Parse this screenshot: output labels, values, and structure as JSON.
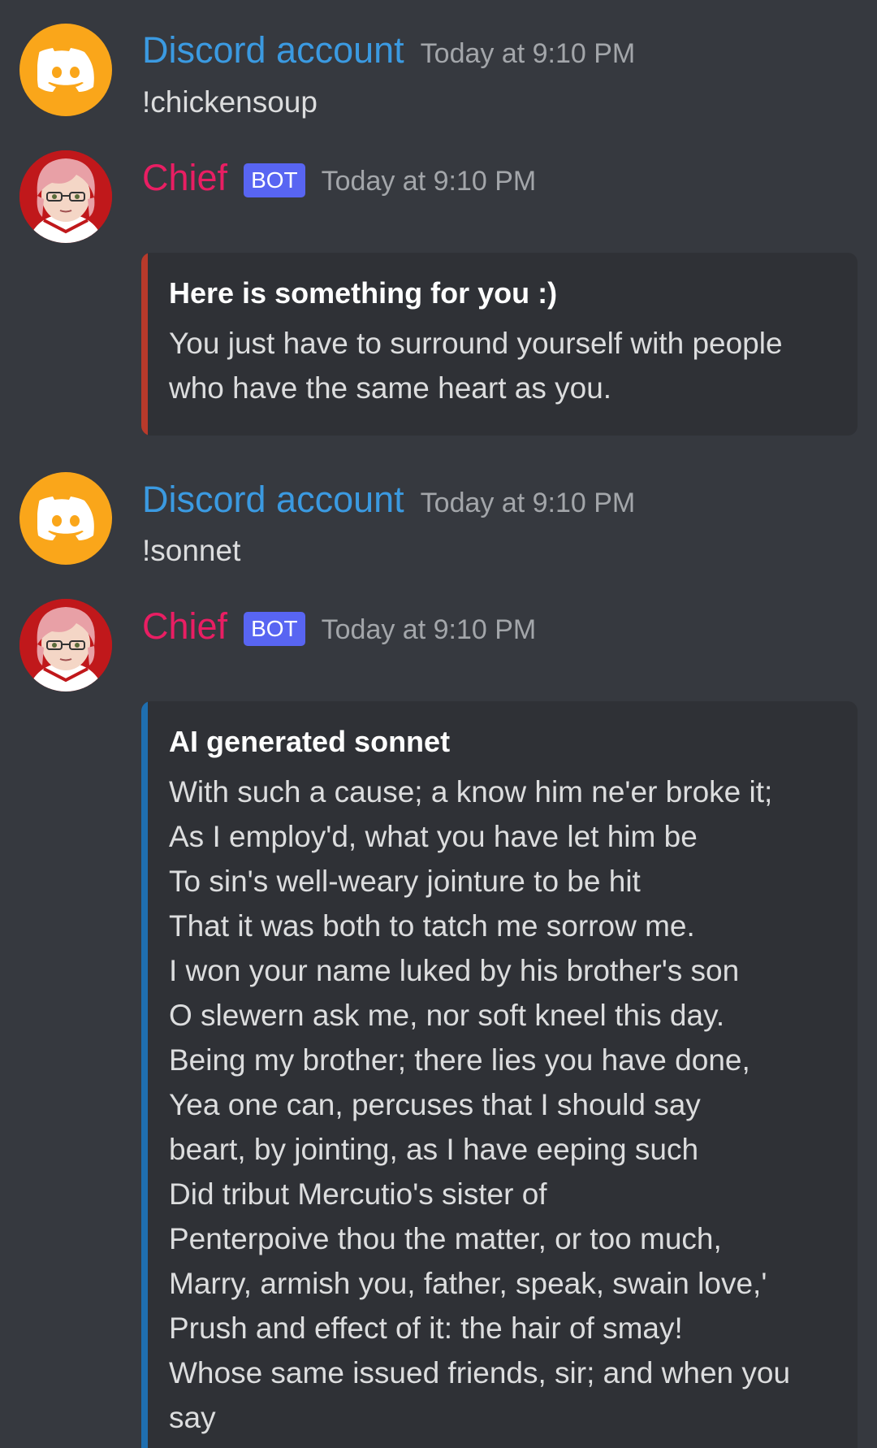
{
  "colors": {
    "background": "#36393f",
    "embed_bg": "#2f3136",
    "discord_avatar": "#faa61a",
    "username_blue": "#3b9ae1",
    "username_pink": "#e91e63",
    "bot_tag": "#5865f2",
    "embed_bar_red": "#b83a2b",
    "embed_bar_blue": "#1f6fb0"
  },
  "messages": [
    {
      "author": "Discord account",
      "avatar_icon": "discord-logo-icon",
      "timestamp": "Today at 9:10 PM",
      "content": "!chickensoup"
    },
    {
      "author": "Chief",
      "bot_tag": "BOT",
      "avatar_icon": "anime-character-avatar",
      "timestamp": "Today at 9:10 PM",
      "embed": {
        "title": "Here is something for you :)",
        "lines": [
          "You just have to surround yourself with people",
          "who have the same heart as you."
        ]
      }
    },
    {
      "author": "Discord account",
      "avatar_icon": "discord-logo-icon",
      "timestamp": "Today at 9:10 PM",
      "content": "!sonnet"
    },
    {
      "author": "Chief",
      "bot_tag": "BOT",
      "avatar_icon": "anime-character-avatar",
      "timestamp": "Today at 9:10 PM",
      "embed": {
        "title": "AI generated sonnet",
        "lines": [
          "With such a cause; a know him ne'er broke it;",
          "As I employ'd, what you have let him be",
          "To sin's well-weary jointure to be hit",
          "That it was both to tatch me sorrow me.",
          "I won your name luked by his brother's son",
          "O slewern ask me, nor soft kneel this day.",
          "Being my brother; there lies you have done,",
          "Yea one can, percuses that I should say",
          "beart, by jointing, as I have eeping such",
          "Did tribut Mercutio's sister of",
          "Penterpoive thou the matter, or too much,",
          "Marry, armish you, father, speak, swain love,'",
          "Prush and effect of it: the hair of smay!",
          "Whose same issued friends, sir; and when you",
          "say"
        ]
      }
    }
  ]
}
